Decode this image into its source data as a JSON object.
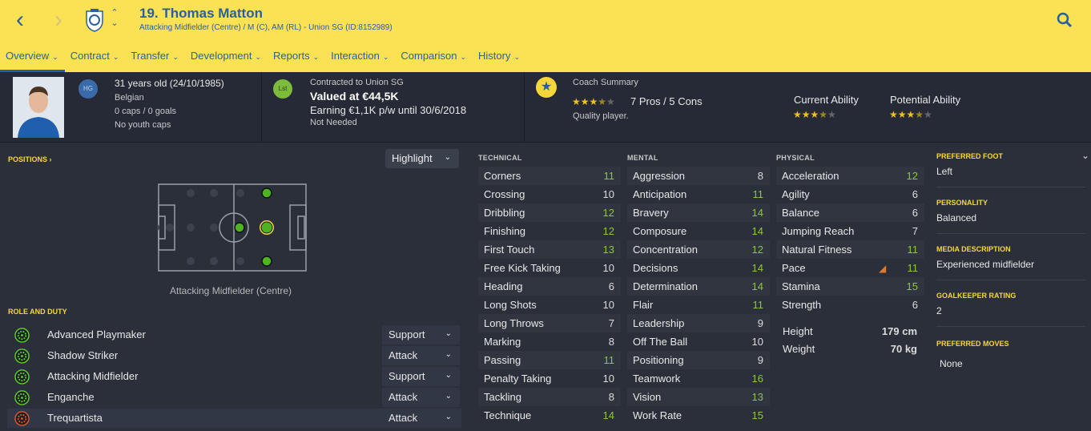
{
  "header": {
    "player_title": "19. Thomas Matton",
    "player_subtitle": "Attacking Midfielder (Centre) / M (C), AM (RL) - Union SG (ID:8152989)",
    "tabs": [
      {
        "label": "Overview",
        "active": true
      },
      {
        "label": "Contract"
      },
      {
        "label": "Transfer"
      },
      {
        "label": "Development"
      },
      {
        "label": "Reports"
      },
      {
        "label": "Interaction"
      },
      {
        "label": "Comparison"
      },
      {
        "label": "History"
      }
    ],
    "accent": "#fbe154",
    "text_color": "#2a5f9e"
  },
  "info": {
    "hg_badge": "HG",
    "age_line": "31 years old (24/10/1985)",
    "nationality": "Belgian",
    "caps": "0 caps / 0 goals",
    "youth_caps": "No youth caps",
    "lst_badge": "Lst",
    "contract_line": "Contracted to Union SG",
    "value_line": "Valued at €44,5K",
    "wage_line": "Earning €1,1K p/w until 30/6/2018",
    "status_line": "Not Needed",
    "coach_title": "Coach Summary",
    "coach_stars": 3.5,
    "pros_cons": "7 Pros / 5 Cons",
    "coach_verdict": "Quality player.",
    "current_ability_label": "Current Ability",
    "current_ability_stars": 3.5,
    "potential_ability_label": "Potential Ability",
    "potential_ability_stars": 3.5
  },
  "positions": {
    "title": "POSITIONS",
    "highlight_label": "Highlight",
    "caption": "Attacking Midfielder (Centre)"
  },
  "roles": {
    "title": "ROLE AND DUTY",
    "items": [
      {
        "name": "Advanced Playmaker",
        "duty": "Support",
        "icon_color": "#5fd12a"
      },
      {
        "name": "Shadow Striker",
        "duty": "Attack",
        "icon_color": "#5fd12a"
      },
      {
        "name": "Attacking Midfielder",
        "duty": "Support",
        "icon_color": "#5fd12a"
      },
      {
        "name": "Enganche",
        "duty": "Attack",
        "icon_color": "#5fd12a"
      },
      {
        "name": "Trequartista",
        "duty": "Attack",
        "icon_color": "#e05a2a"
      }
    ]
  },
  "technical": {
    "title": "TECHNICAL",
    "attrs": [
      {
        "name": "Corners",
        "value": "11"
      },
      {
        "name": "Crossing",
        "value": "10"
      },
      {
        "name": "Dribbling",
        "value": "12"
      },
      {
        "name": "Finishing",
        "value": "12"
      },
      {
        "name": "First Touch",
        "value": "13"
      },
      {
        "name": "Free Kick Taking",
        "value": "10"
      },
      {
        "name": "Heading",
        "value": "6"
      },
      {
        "name": "Long Shots",
        "value": "10"
      },
      {
        "name": "Long Throws",
        "value": "7"
      },
      {
        "name": "Marking",
        "value": "8"
      },
      {
        "name": "Passing",
        "value": "11"
      },
      {
        "name": "Penalty Taking",
        "value": "10"
      },
      {
        "name": "Tackling",
        "value": "8"
      },
      {
        "name": "Technique",
        "value": "14"
      }
    ]
  },
  "mental": {
    "title": "MENTAL",
    "attrs": [
      {
        "name": "Aggression",
        "value": "8"
      },
      {
        "name": "Anticipation",
        "value": "11"
      },
      {
        "name": "Bravery",
        "value": "14"
      },
      {
        "name": "Composure",
        "value": "14"
      },
      {
        "name": "Concentration",
        "value": "12"
      },
      {
        "name": "Decisions",
        "value": "14"
      },
      {
        "name": "Determination",
        "value": "14"
      },
      {
        "name": "Flair",
        "value": "11"
      },
      {
        "name": "Leadership",
        "value": "9"
      },
      {
        "name": "Off The Ball",
        "value": "10"
      },
      {
        "name": "Positioning",
        "value": "9"
      },
      {
        "name": "Teamwork",
        "value": "16"
      },
      {
        "name": "Vision",
        "value": "13"
      },
      {
        "name": "Work Rate",
        "value": "15"
      }
    ]
  },
  "physical": {
    "title": "PHYSICAL",
    "attrs": [
      {
        "name": "Acceleration",
        "value": "12"
      },
      {
        "name": "Agility",
        "value": "6"
      },
      {
        "name": "Balance",
        "value": "6"
      },
      {
        "name": "Jumping Reach",
        "value": "7"
      },
      {
        "name": "Natural Fitness",
        "value": "11"
      },
      {
        "name": "Pace",
        "value": "11"
      },
      {
        "name": "Stamina",
        "value": "15"
      },
      {
        "name": "Strength",
        "value": "6"
      }
    ],
    "height_label": "Height",
    "height_value": "179 cm",
    "weight_label": "Weight",
    "weight_value": "70 kg"
  },
  "side": {
    "preferred_foot_label": "PREFERRED FOOT",
    "preferred_foot": "Left",
    "personality_label": "PERSONALITY",
    "personality": "Balanced",
    "media_label": "MEDIA DESCRIPTION",
    "media": "Experienced midfielder",
    "gk_label": "GOALKEEPER RATING",
    "gk": "2",
    "moves_label": "PREFERRED MOVES",
    "moves": "None"
  }
}
